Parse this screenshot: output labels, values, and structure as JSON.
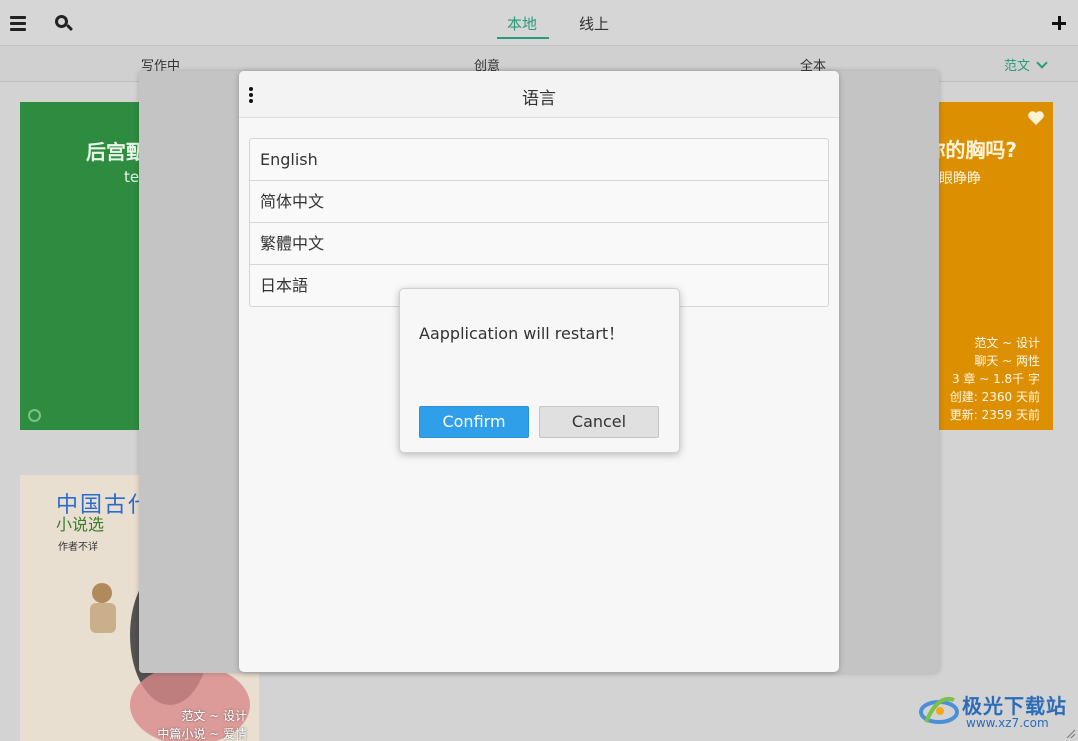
{
  "topbar": {
    "tabs": [
      {
        "label": "本地",
        "active": true
      },
      {
        "label": "线上",
        "active": false
      }
    ],
    "icons": [
      "menu-icon",
      "search-icon",
      "plus-icon"
    ],
    "accent": "#2a9a7b"
  },
  "filters": {
    "items": [
      "写作中",
      "创意",
      "全本"
    ],
    "dropdown": "范文"
  },
  "cards": {
    "green": {
      "title": "后宫甄",
      "subtitle": "te",
      "color": "#2e8c40"
    },
    "orange": {
      "title": "你的胸吗?",
      "subtitle": "眼睁睁",
      "meta": [
        "范文 ~ 设计",
        "聊天 ~ 两性",
        "3 章 ~ 1.8千 字",
        "创建: 2360 天前",
        "更新: 2359 天前"
      ],
      "color": "#dc8f00"
    },
    "poster": {
      "title": "中国古代",
      "subtitle": "小说选",
      "author": "作者不详",
      "meta": [
        "范文 ~ 设计",
        "中篇小说 ~ 爱情"
      ]
    }
  },
  "language_dialog": {
    "title": "语言",
    "options": [
      "English",
      "简体中文",
      "繁體中文",
      "日本語"
    ]
  },
  "alert": {
    "message": "Aapplication will restart！",
    "confirm_label": "Confirm",
    "cancel_label": "Cancel",
    "confirm_color": "#2f9fea"
  },
  "watermark": {
    "text": "极光下载站",
    "url": "www.xz7.com"
  }
}
